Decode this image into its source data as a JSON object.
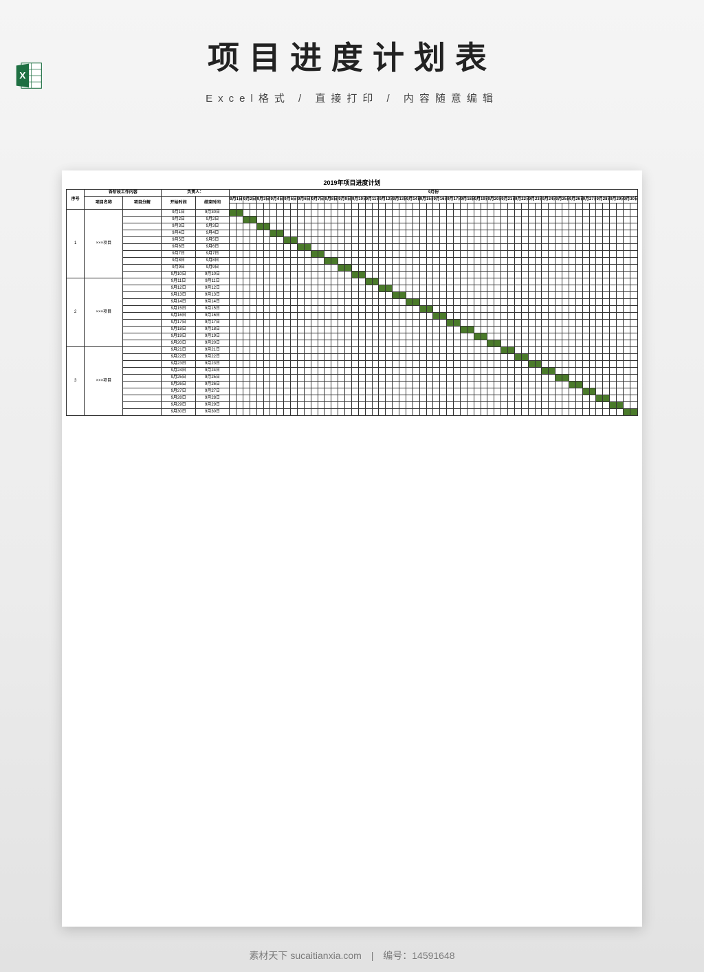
{
  "page": {
    "title": "项目进度计划表",
    "subtitle": "Excel格式 / 直接打印 / 内容随意编辑"
  },
  "footer": {
    "site_label": "素材天下",
    "site_url": "sucaitianxia.com",
    "id_label": "编号：",
    "id_value": "14591648"
  },
  "chart_data": {
    "type": "table",
    "title": "2019年项目进度计划",
    "month_label": "9月份",
    "headers": {
      "seq": "序号",
      "stage_content": "各阶段工作内容",
      "project_name": "项目名称",
      "project_break": "项目分解",
      "owner": "负责人：",
      "start": "开始时间",
      "end": "结束时间"
    },
    "day_count": 60,
    "day_header_prefix": "9月",
    "day_header_suffix": "日",
    "groups": [
      {
        "seq": "1",
        "name": "×××项目",
        "rows": [
          {
            "start": "9月1日",
            "end": "9月30日",
            "bar_from": 0,
            "bar_to": 1
          },
          {
            "start": "9月2日",
            "end": "9月2日",
            "bar_from": 2,
            "bar_to": 3
          },
          {
            "start": "9月3日",
            "end": "9月3日",
            "bar_from": 4,
            "bar_to": 5
          },
          {
            "start": "9月4日",
            "end": "9月4日",
            "bar_from": 6,
            "bar_to": 7
          },
          {
            "start": "9月5日",
            "end": "9月5日",
            "bar_from": 8,
            "bar_to": 9
          },
          {
            "start": "9月6日",
            "end": "9月6日",
            "bar_from": 10,
            "bar_to": 11
          },
          {
            "start": "9月7日",
            "end": "9月7日",
            "bar_from": 12,
            "bar_to": 13
          },
          {
            "start": "9月8日",
            "end": "9月8日",
            "bar_from": 14,
            "bar_to": 15
          },
          {
            "start": "9月9日",
            "end": "9月9日",
            "bar_from": 16,
            "bar_to": 17
          },
          {
            "start": "9月10日",
            "end": "9月10日",
            "bar_from": 18,
            "bar_to": 19
          }
        ]
      },
      {
        "seq": "2",
        "name": "×××项目",
        "rows": [
          {
            "start": "9月11日",
            "end": "9月11日",
            "bar_from": 20,
            "bar_to": 21
          },
          {
            "start": "9月12日",
            "end": "9月12日",
            "bar_from": 22,
            "bar_to": 23
          },
          {
            "start": "9月13日",
            "end": "9月13日",
            "bar_from": 24,
            "bar_to": 25
          },
          {
            "start": "9月14日",
            "end": "9月14日",
            "bar_from": 26,
            "bar_to": 27
          },
          {
            "start": "9月15日",
            "end": "9月15日",
            "bar_from": 28,
            "bar_to": 29
          },
          {
            "start": "9月16日",
            "end": "9月16日",
            "bar_from": 30,
            "bar_to": 31
          },
          {
            "start": "9月17日",
            "end": "9月17日",
            "bar_from": 32,
            "bar_to": 33
          },
          {
            "start": "9月18日",
            "end": "9月18日",
            "bar_from": 34,
            "bar_to": 35
          },
          {
            "start": "9月19日",
            "end": "9月19日",
            "bar_from": 36,
            "bar_to": 37
          },
          {
            "start": "9月20日",
            "end": "9月20日",
            "bar_from": 38,
            "bar_to": 39
          }
        ]
      },
      {
        "seq": "3",
        "name": "×××项目",
        "rows": [
          {
            "start": "9月21日",
            "end": "9月21日",
            "bar_from": 40,
            "bar_to": 41
          },
          {
            "start": "9月22日",
            "end": "9月22日",
            "bar_from": 42,
            "bar_to": 43
          },
          {
            "start": "9月23日",
            "end": "9月23日",
            "bar_from": 44,
            "bar_to": 45
          },
          {
            "start": "9月24日",
            "end": "9月24日",
            "bar_from": 46,
            "bar_to": 47
          },
          {
            "start": "9月25日",
            "end": "9月25日",
            "bar_from": 48,
            "bar_to": 49
          },
          {
            "start": "9月26日",
            "end": "9月26日",
            "bar_from": 50,
            "bar_to": 51
          },
          {
            "start": "9月27日",
            "end": "9月27日",
            "bar_from": 52,
            "bar_to": 53
          },
          {
            "start": "9月28日",
            "end": "9月28日",
            "bar_from": 54,
            "bar_to": 55
          },
          {
            "start": "9月29日",
            "end": "9月29日",
            "bar_from": 56,
            "bar_to": 57
          },
          {
            "start": "9月30日",
            "end": "9月30日",
            "bar_from": 58,
            "bar_to": 59
          }
        ]
      }
    ]
  }
}
